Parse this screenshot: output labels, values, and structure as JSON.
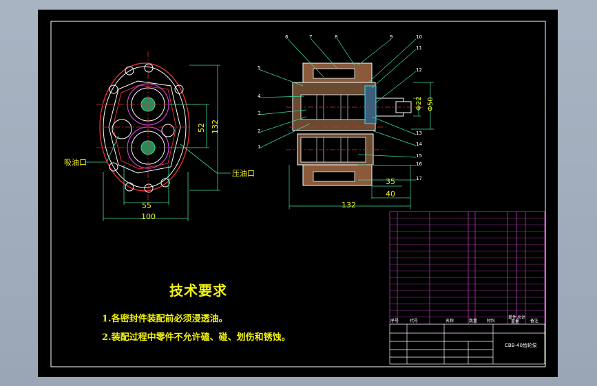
{
  "drawing": {
    "requirements": {
      "title": "技术要求",
      "line1": "1.各密封件装配前必须浸透油。",
      "line2": "2.装配过程中零件不允许磕、碰、划伤和锈蚀。"
    },
    "left_view": {
      "inlet_label": "吸油口",
      "outlet_label": "压油口",
      "dim_55": "55",
      "dim_100": "100",
      "dim_52": "52",
      "dim_132": "132"
    },
    "section_view": {
      "dim_35": "35",
      "dim_40": "40",
      "dim_132": "132",
      "dim_d22": "Φ22",
      "dim_d50": "Φ50",
      "balloons": [
        "6",
        "7",
        "8",
        "9",
        "10",
        "11",
        "12",
        "5",
        "4",
        "3",
        "2",
        "1",
        "13",
        "14",
        "15",
        "16",
        "17"
      ]
    },
    "title_block": {
      "hdr_no": "序号",
      "hdr_code": "代号",
      "hdr_name": "名称",
      "hdr_qty": "数量",
      "hdr_material": "材料",
      "hdr_single": "单件",
      "hdr_total": "总计",
      "hdr_weight": "重量",
      "hdr_remark": "备注",
      "drawing_name": "CBB-40齿轮泵"
    }
  }
}
